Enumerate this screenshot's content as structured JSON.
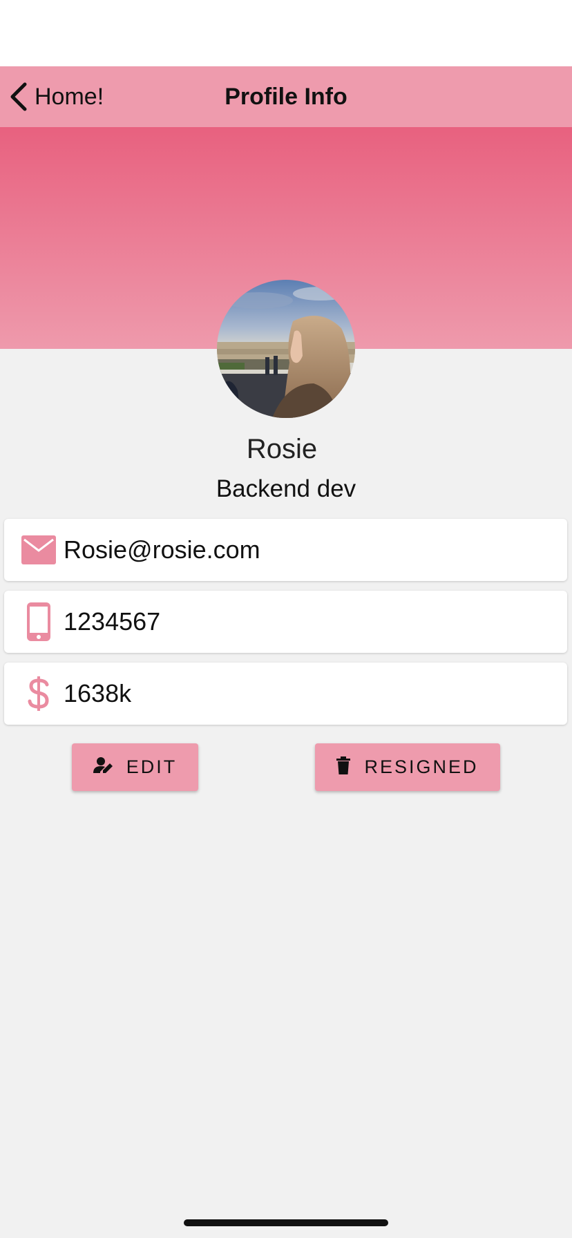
{
  "nav": {
    "back_label": "Home!",
    "title": "Profile Info"
  },
  "profile": {
    "name": "Rosie",
    "role": "Backend dev"
  },
  "contact": {
    "email": "Rosie@rosie.com",
    "phone": "1234567",
    "salary": "1638k"
  },
  "actions": {
    "edit_label": "EDIT",
    "resign_label": "RESIGNED"
  },
  "icons": {
    "back": "chevron-left-icon",
    "email": "mail-icon",
    "phone": "phone-icon",
    "salary": "dollar-icon",
    "edit": "user-edit-icon",
    "resign": "trash-icon"
  },
  "colors": {
    "accent": "#ee9bad",
    "hero_top": "#e8617f",
    "hero_bottom": "#ee9aac",
    "background": "#f1f1f1",
    "icon": "#ea8ba0"
  }
}
